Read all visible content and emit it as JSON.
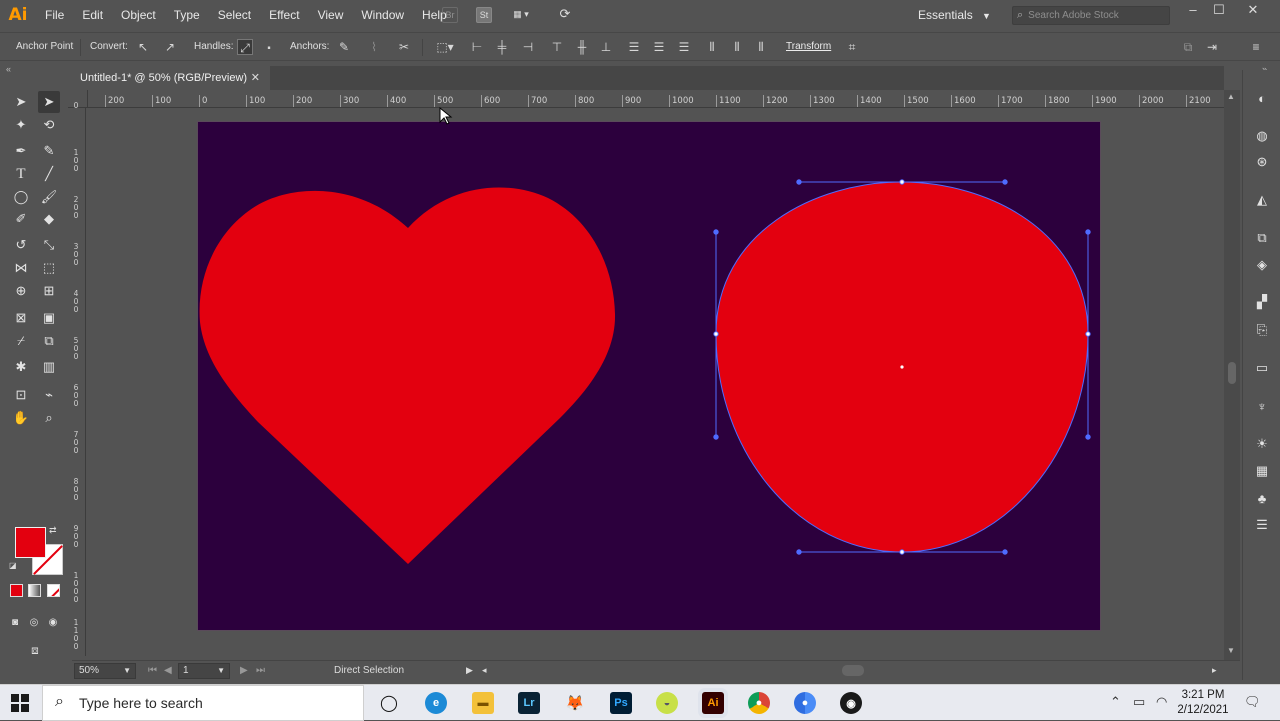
{
  "app": {
    "logo": "Ai",
    "menu": [
      "File",
      "Edit",
      "Object",
      "Type",
      "Select",
      "Effect",
      "View",
      "Window",
      "Help"
    ],
    "menu_icons": [
      "bridge-icon",
      "stock-icon",
      "arrange-documents-icon",
      "gpu-performance-icon"
    ],
    "workspace": "Essentials",
    "stock_search_placeholder": "Search Adobe Stock",
    "accent": "#ff9a00"
  },
  "control_bar": {
    "anchor_point_label": "Anchor Point",
    "convert_label": "Convert:",
    "handles_label": "Handles:",
    "anchors_label": "Anchors:",
    "transform_label": "Transform"
  },
  "document": {
    "tab_title": "Untitled-1* @ 50% (RGB/Preview)",
    "artboard_color": "#2c003d",
    "shape_fill": "#e3000f",
    "selection_color": "#4f6bff"
  },
  "ruler": {
    "top_ticks": [
      "200",
      "100",
      "0",
      "100",
      "200",
      "300",
      "400",
      "500",
      "600",
      "700",
      "800",
      "900",
      "1000",
      "1100",
      "1200",
      "1300",
      "1400",
      "1500",
      "1600",
      "1700",
      "1800",
      "1900",
      "2000",
      "2100"
    ],
    "left_ticks": [
      "0",
      "1\n0\n0",
      "2\n0\n0",
      "3\n0\n0",
      "4\n0\n0",
      "5\n0\n0",
      "6\n0\n0",
      "7\n0\n0",
      "8\n0\n0",
      "9\n0\n0",
      "1\n0\n0\n0",
      "1\n1\n0\n0"
    ]
  },
  "status_bar": {
    "zoom": "50%",
    "artboard_number": "1",
    "current_tool": "Direct Selection"
  },
  "taskbar": {
    "search_placeholder": "Type here to search",
    "apps": [
      "task-view",
      "edge",
      "file-explorer",
      "lightroom",
      "gimp",
      "photoshop",
      "tennis-app",
      "illustrator",
      "chrome",
      "chrome-alt",
      "obs"
    ],
    "time": "3:21 PM",
    "date": "2/12/2021"
  }
}
